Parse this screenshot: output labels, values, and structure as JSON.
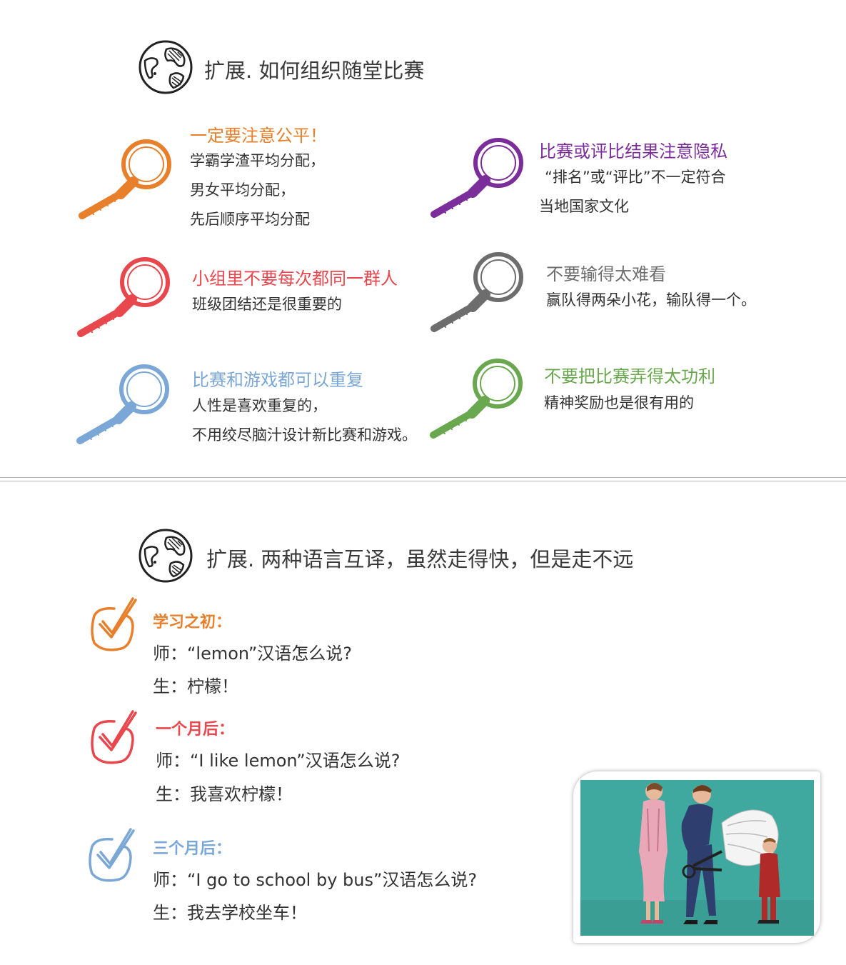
{
  "section1": {
    "title": "扩展. 如何组织随堂比赛",
    "items": [
      {
        "color": "#e87f2a",
        "heading": "一定要注意公平！",
        "lines": [
          "学霸学渣平均分配，",
          "男女平均分配，",
          "先后顺序平均分配"
        ]
      },
      {
        "color": "#7b2d9c",
        "heading": "比赛或评比结果注意隐私",
        "lines": [
          "“排名”或“评比”不一定符合",
          "当地国家文化"
        ]
      },
      {
        "color": "#e8474d",
        "heading": "小组里不要每次都同一群人",
        "lines": [
          "班级团结还是很重要的"
        ]
      },
      {
        "color": "#6d6d6d",
        "heading": "不要输得太难看",
        "lines": [
          "赢队得两朵小花，输队得一个。"
        ]
      },
      {
        "color": "#7aa7d6",
        "heading": "比赛和游戏都可以重复",
        "lines": [
          "人性是喜欢重复的，",
          "不用绞尽脑汁设计新比赛和游戏。"
        ]
      },
      {
        "color": "#6aa84f",
        "heading": "不要把比赛弄得太功利",
        "lines": [
          "精神奖励也是很有用的"
        ]
      }
    ]
  },
  "section2": {
    "title": "扩展. 两种语言互译，虽然走得快，但是走不远",
    "stages": [
      {
        "color": "#e87f2a",
        "heading": "学习之初：",
        "teacher": "师：“lemon”汉语怎么说?",
        "student": "生：柠檬！"
      },
      {
        "color": "#e8474d",
        "heading": "一个月后：",
        "teacher": "师：“I like lemon”汉语怎么说?",
        "student": "生：我喜欢柠檬！"
      },
      {
        "color": "#7aa7d6",
        "heading": "三个月后：",
        "teacher": "师：“I go to school by bus”汉语怎么说?",
        "student": "生：我去学校坐车！"
      }
    ]
  },
  "icons": {
    "globe": "globe-icon",
    "magnifier": "magnifying-glass-icon",
    "check": "checkbox-checked-icon"
  }
}
